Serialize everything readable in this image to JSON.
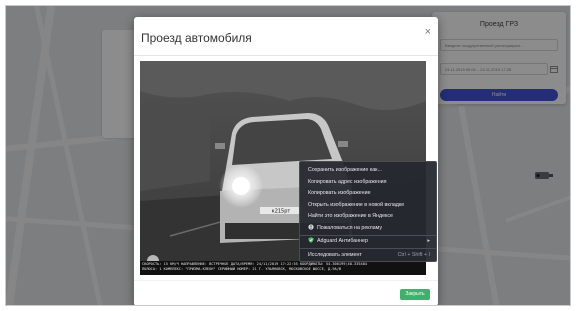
{
  "background": {
    "panel_title": "Проезд ГРЗ",
    "plate_input_placeholder": "Введите государственный регистрацион...",
    "date_from": "24.11.2019 00:00",
    "date_to": "24.11.2019 17:28",
    "search_button": "Найти"
  },
  "modal": {
    "title": "Проезд автомобиля",
    "close_icon": "×",
    "plate": "к215рт",
    "caption_lines": [
      "СКОРОСТЬ: 15 КМ/Ч   НАПРАВЛЕНИЕ: ВСТРЕЧНОЕ   ДАТА/ВРЕМЯ: 24/11/2019 17:22:55   КООРДИНАТЫ: 54.306199;48.335484",
      "ПОЛОСА: 1   КОМПЛЕКС: \"ПРИЗМА-КЛЕОН\"   СЕРИЙНЫЙ НОМЕР: 21   Г. УЛЬЯНОВСК, МОСКОВСКОЕ ШОССЕ, Д.9А/В"
    ],
    "close_button": "Закрыть"
  },
  "context_menu": {
    "items": [
      {
        "label": "Сохранить изображение как..."
      },
      {
        "label": "Копировать адрес изображения"
      },
      {
        "label": "Копировать изображение"
      },
      {
        "label": "Открыть изображение в новой вкладке"
      },
      {
        "label": "Найти это изображение в Яндексе"
      },
      {
        "label": "Пожаловаться на рекламу"
      },
      {
        "label": "Adguard Антибаннер"
      },
      {
        "label": "Исследовать элемент",
        "shortcut": "Ctrl + Shift + I"
      }
    ]
  },
  "colors": {
    "accent": "#4353d6",
    "close_button": "#36b56b",
    "menu_bg": "#262830"
  }
}
